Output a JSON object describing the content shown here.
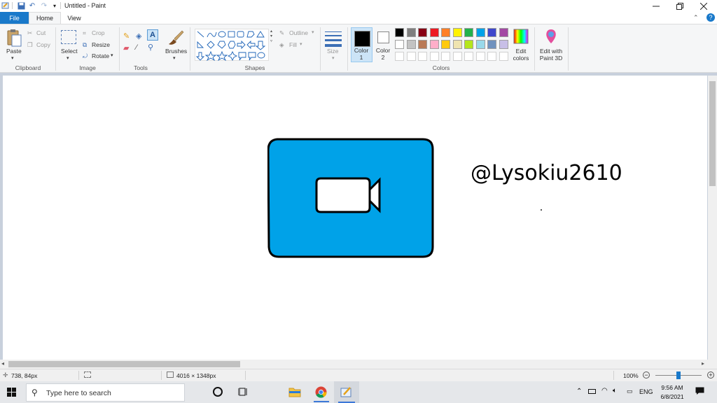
{
  "window": {
    "title": "Untitled - Paint",
    "qat_dropdown": "▾"
  },
  "tabs": [
    "File",
    "Home",
    "View"
  ],
  "clipboard": {
    "paste": "Paste",
    "cut": "Cut",
    "copy": "Copy",
    "group": "Clipboard"
  },
  "image": {
    "select": "Select",
    "crop": "Crop",
    "resize": "Resize",
    "rotate": "Rotate",
    "group": "Image"
  },
  "tools": {
    "group": "Tools",
    "brushes": "Brushes"
  },
  "shapes": {
    "group": "Shapes",
    "outline": "Outline",
    "fill": "Fill"
  },
  "size": {
    "label": "Size"
  },
  "colors": {
    "group": "Colors",
    "color1": "Color 1",
    "color2": "Color 2",
    "edit": "Edit colors",
    "paint3d": "Edit with Paint 3D",
    "row1": [
      "#000000",
      "#7f7f7f",
      "#880015",
      "#ed1c24",
      "#ff7f27",
      "#fff200",
      "#22b14c",
      "#00a2e8",
      "#3f48cc",
      "#a349a4"
    ],
    "row2": [
      "#ffffff",
      "#c3c3c3",
      "#b97a57",
      "#ffaec9",
      "#ffc90e",
      "#efe4b0",
      "#b5e61d",
      "#99d9ea",
      "#7092be",
      "#c8bfe7"
    ],
    "row3": [
      "#ffffff",
      "#ffffff",
      "#ffffff",
      "#ffffff",
      "#ffffff",
      "#ffffff",
      "#ffffff",
      "#ffffff",
      "#ffffff",
      "#ffffff"
    ],
    "accent": "#00a2e8"
  },
  "canvas": {
    "handle_text": "@Lysokiu2610"
  },
  "status": {
    "cursor": "738, 84px",
    "image_size": "4016 × 1348px",
    "zoom": "100%"
  },
  "taskbar": {
    "search_placeholder": "Type here to search",
    "lang": "ENG",
    "time": "9:56 AM",
    "date": "6/8/2021"
  }
}
